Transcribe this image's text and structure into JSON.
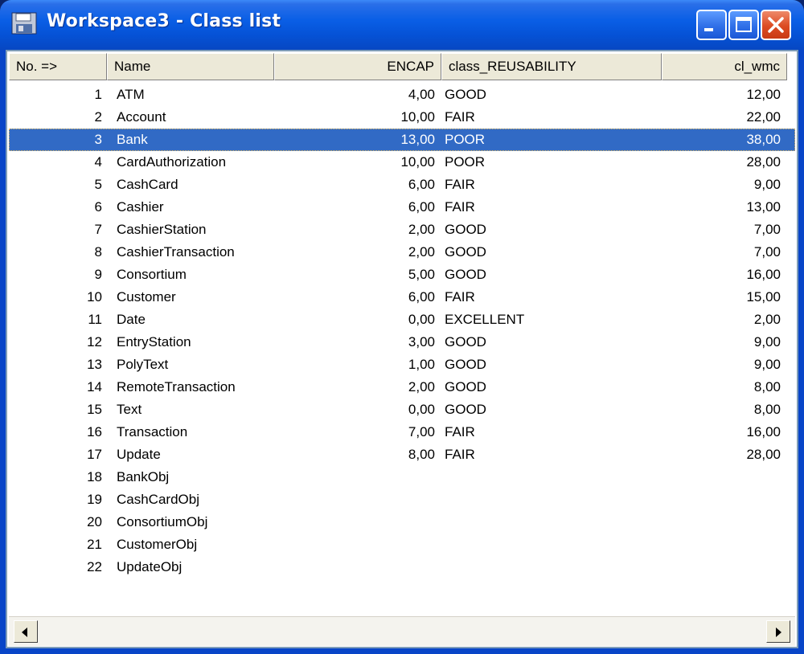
{
  "window": {
    "title": "Workspace3 - Class list",
    "icon": "floppy-disk-icon",
    "controls": [
      "minimize",
      "maximize",
      "close"
    ]
  },
  "table": {
    "columns": [
      {
        "key": "no",
        "label": "No. =>"
      },
      {
        "key": "name",
        "label": "Name"
      },
      {
        "key": "encap",
        "label": "ENCAP"
      },
      {
        "key": "reuse",
        "label": "class_REUSABILITY"
      },
      {
        "key": "wmc",
        "label": "cl_wmc"
      }
    ],
    "selected_row": 2,
    "rows": [
      {
        "no": "1",
        "name": "ATM",
        "encap": "4,00",
        "reuse": "GOOD",
        "wmc": "12,00"
      },
      {
        "no": "2",
        "name": "Account",
        "encap": "10,00",
        "reuse": "FAIR",
        "wmc": "22,00"
      },
      {
        "no": "3",
        "name": "Bank",
        "encap": "13,00",
        "reuse": "POOR",
        "wmc": "38,00"
      },
      {
        "no": "4",
        "name": "CardAuthorization",
        "encap": "10,00",
        "reuse": "POOR",
        "wmc": "28,00"
      },
      {
        "no": "5",
        "name": "CashCard",
        "encap": "6,00",
        "reuse": "FAIR",
        "wmc": "9,00"
      },
      {
        "no": "6",
        "name": "Cashier",
        "encap": "6,00",
        "reuse": "FAIR",
        "wmc": "13,00"
      },
      {
        "no": "7",
        "name": "CashierStation",
        "encap": "2,00",
        "reuse": "GOOD",
        "wmc": "7,00"
      },
      {
        "no": "8",
        "name": "CashierTransaction",
        "encap": "2,00",
        "reuse": "GOOD",
        "wmc": "7,00"
      },
      {
        "no": "9",
        "name": "Consortium",
        "encap": "5,00",
        "reuse": "GOOD",
        "wmc": "16,00"
      },
      {
        "no": "10",
        "name": "Customer",
        "encap": "6,00",
        "reuse": "FAIR",
        "wmc": "15,00"
      },
      {
        "no": "11",
        "name": "Date",
        "encap": "0,00",
        "reuse": "EXCELLENT",
        "wmc": "2,00"
      },
      {
        "no": "12",
        "name": "EntryStation",
        "encap": "3,00",
        "reuse": "GOOD",
        "wmc": "9,00"
      },
      {
        "no": "13",
        "name": "PolyText",
        "encap": "1,00",
        "reuse": "GOOD",
        "wmc": "9,00"
      },
      {
        "no": "14",
        "name": "RemoteTransaction",
        "encap": "2,00",
        "reuse": "GOOD",
        "wmc": "8,00"
      },
      {
        "no": "15",
        "name": "Text",
        "encap": "0,00",
        "reuse": "GOOD",
        "wmc": "8,00"
      },
      {
        "no": "16",
        "name": "Transaction",
        "encap": "7,00",
        "reuse": "FAIR",
        "wmc": "16,00"
      },
      {
        "no": "17",
        "name": "Update",
        "encap": "8,00",
        "reuse": "FAIR",
        "wmc": "28,00"
      },
      {
        "no": "18",
        "name": "BankObj",
        "encap": "",
        "reuse": "",
        "wmc": ""
      },
      {
        "no": "19",
        "name": "CashCardObj",
        "encap": "",
        "reuse": "",
        "wmc": ""
      },
      {
        "no": "20",
        "name": "ConsortiumObj",
        "encap": "",
        "reuse": "",
        "wmc": ""
      },
      {
        "no": "21",
        "name": "CustomerObj",
        "encap": "",
        "reuse": "",
        "wmc": ""
      },
      {
        "no": "22",
        "name": "UpdateObj",
        "encap": "",
        "reuse": "",
        "wmc": ""
      }
    ]
  },
  "scrollbar": {
    "left_icon": "arrow-left-icon",
    "right_icon": "arrow-right-icon"
  },
  "colors": {
    "titlebar": "#0a5fe6",
    "selection": "#316ac5",
    "close_button": "#dc4b22"
  }
}
